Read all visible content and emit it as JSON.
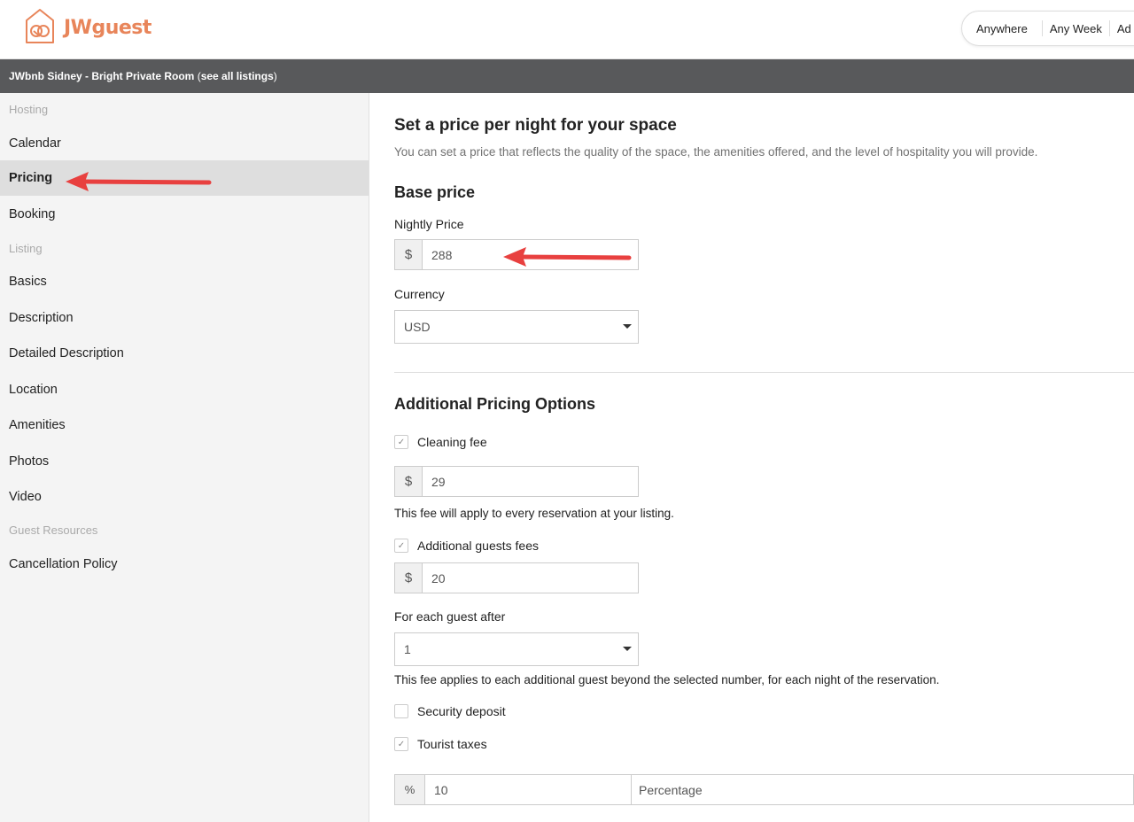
{
  "app": {
    "logo_text": "JWguest",
    "brand_color": "#e8855a"
  },
  "header": {
    "search_pill": [
      "Anywhere",
      "Any Week",
      "Ad"
    ]
  },
  "listing_bar": {
    "title": "JWbnb Sidney - Bright Private Room",
    "open_paren": " (",
    "link_text": "see all listings",
    "close_paren": ")"
  },
  "sidebar": {
    "heading_hosting": "Hosting",
    "heading_listing": "Listing",
    "heading_guest": "Guest Resources",
    "items": {
      "calendar": "Calendar",
      "pricing": "Pricing",
      "booking": "Booking",
      "basics": "Basics",
      "description": "Description",
      "detailed_description": "Detailed Description",
      "location": "Location",
      "amenities": "Amenities",
      "photos": "Photos",
      "video": "Video",
      "cancellation": "Cancellation Policy"
    },
    "active_item": "Pricing"
  },
  "main": {
    "title": "Set a price per night for your space",
    "subtitle": "You can set a price that reflects the quality of the space, the amenities offered, and the level of hospitality you will provide.",
    "base_price": {
      "heading": "Base price",
      "nightly_label": "Nightly Price",
      "currency_symbol": "$",
      "nightly_value": "288",
      "currency_label": "Currency",
      "currency_value": "USD"
    },
    "additional": {
      "heading": "Additional Pricing Options",
      "cleaning_fee": {
        "label": "Cleaning fee",
        "checked": true,
        "symbol": "$",
        "value": "29",
        "help": "This fee will apply to every reservation at your listing."
      },
      "guest_fees": {
        "label": "Additional guests fees",
        "checked": true,
        "symbol": "$",
        "value": "20"
      },
      "each_guest_after": {
        "label": "For each guest after",
        "value": "1",
        "help": "This fee applies to each additional guest beyond the selected number, for each night of the reservation."
      },
      "security_deposit": {
        "label": "Security deposit",
        "checked": false
      },
      "tourist_taxes": {
        "label": "Tourist taxes",
        "checked": true,
        "symbol": "%",
        "value": "10",
        "type": "Percentage"
      }
    }
  },
  "annotation_color": "#e8403f",
  "check_glyph": "✓"
}
